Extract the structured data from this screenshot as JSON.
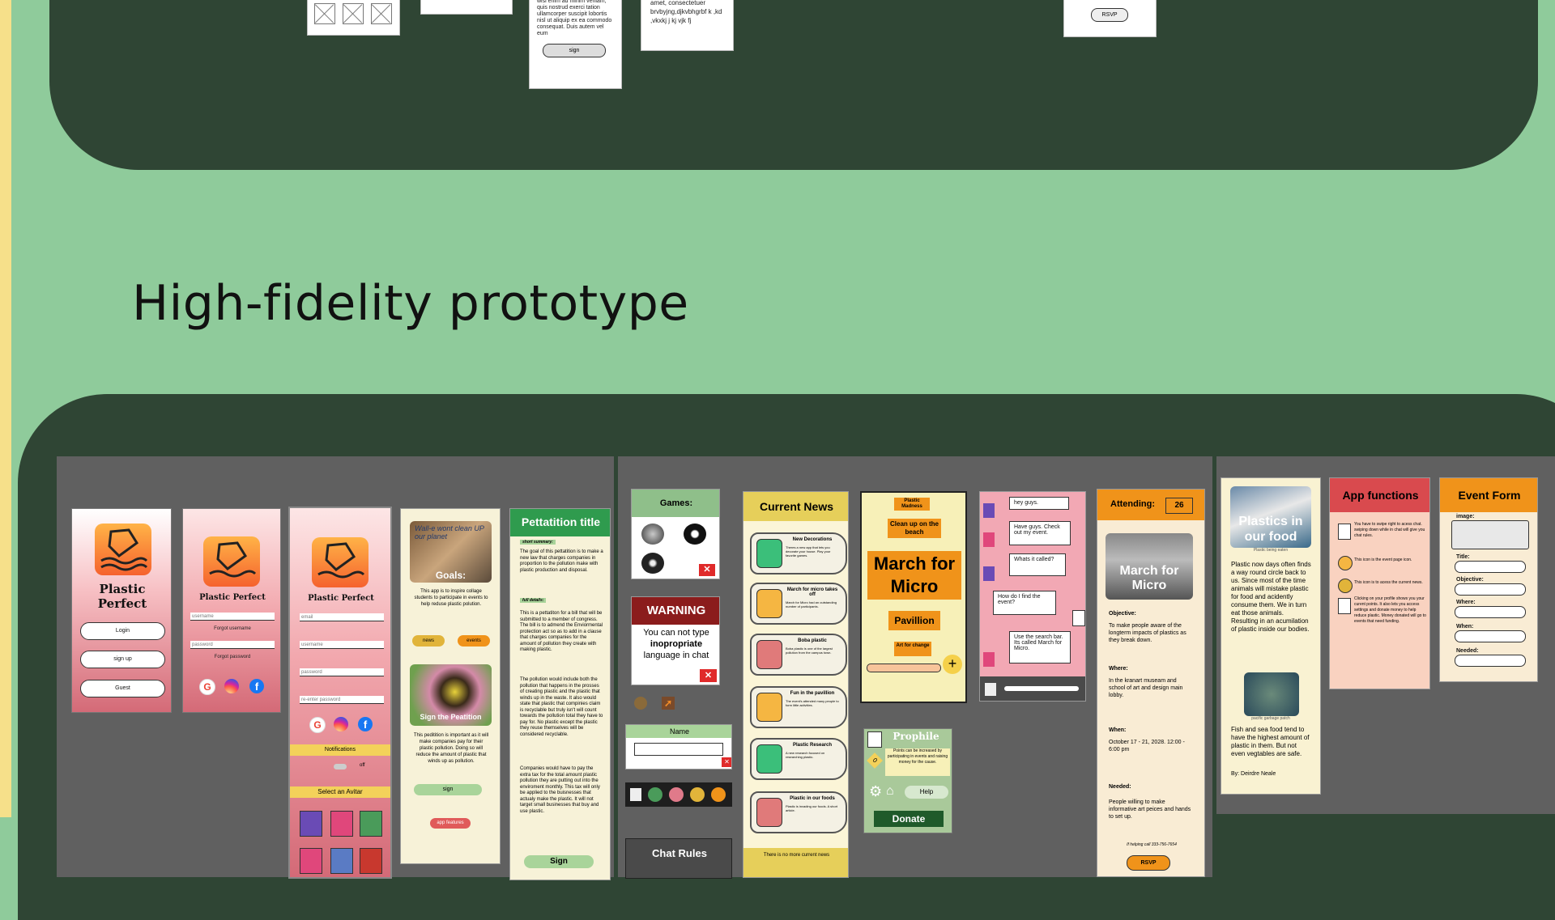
{
  "heading": "High-fidelity prototype",
  "wireframes": {
    "w3_text": "wisi enim ad minim veniam, quis nostrud exerci tation ullamcorper suscipit lobortis nisl ut aliquip ex ea commodo consequat. Duis autem vel eum",
    "w3_button": "sign",
    "w4_text": "amet, consectetuer brvbyjng,djkvbhgrbf k ,kd ,vkxkj j kj vjk fj",
    "w5_button": "RSVP"
  },
  "login": {
    "app_name": "Plastic Perfect",
    "buttons": [
      "Login",
      "sign up",
      "Guest"
    ]
  },
  "forgot": {
    "app_name": "Plastic Perfect",
    "username_placeholder": "username",
    "forgot_username": "Forgot username",
    "password_placeholder": "password",
    "forgot_password": "Forgot password"
  },
  "signup": {
    "app_name": "Plastic Perfect",
    "fields": [
      "email",
      "username",
      "password",
      "re-enter password"
    ],
    "notifications_label": "Notifications",
    "toggle_state": "off",
    "avatar_label": "Select an Avitar"
  },
  "goals": {
    "image_caption": "Goals:",
    "photo_sign_text": "Wall-e wont clean UP our planet",
    "text": "This app is to inspire collage students to participate in events to help reduse plastic polution.",
    "news_button": "news",
    "events_button": "events",
    "petition_caption": "Sign the Peatition",
    "petition_text": "This peditition is important as it will make companies pay for their plastic pollution. Doing so will reduce the amount of plastic that winds up as pollution.",
    "sign_button": "sign",
    "features_button": "app features"
  },
  "petition": {
    "title": "Pettatition title",
    "summary_label": "short summary:",
    "summary": "The goal of this pettatition is to make a new law that charges companies in proportion to the pollution make with plastic production and disposal.",
    "details_label": "full details:",
    "details": "This is a pettatiton for a bill that will be submitted to a member of congress. The bill is to admend the Enviormental protection act so as to add in a clause that charges companies for the amount of pollution they create with making plastic.",
    "details2": "The pollution would include both the pollution that happens in the prosses of creating plastic and the plastic that winds up in the waste. It also would state that plastic that compinies claim is recyclable but truly isn't will count towards the pollution total they have to pay for. No plastic except the plastic they reuse themselves will be considered recyclable.",
    "details3": "Companies would have to pay the extra tax for the total amount plastic pollution they are putting out into the enviroment monthly. This tax will only be applied to the buisnesses that actualy make the plastic. It will not target small businesses that buy and use plastic.",
    "sign_button": "Sign"
  },
  "games": {
    "title": "Games:",
    "warning_title": "WARNING",
    "warning_line1": "You can not type",
    "warning_line2": "inopropriate",
    "warning_line3": "language in chat",
    "name_label": "Name",
    "chat_rules": "Chat Rules"
  },
  "news": {
    "title": "Current News",
    "items": [
      {
        "title": "New Decorations",
        "text": "Theres a new app that lets you decorate your house. Play your favorite games."
      },
      {
        "title": "March for micro takes off",
        "text": "March for Micro had an outstanding number of participants."
      },
      {
        "title": "Boba plastic",
        "text": "Boba plastic is one of the largest pollution from the campus town."
      },
      {
        "title": "Fun in the pavillion",
        "text": "The event's attended many people to form little activities."
      },
      {
        "title": "Plastic Research",
        "text": "A new research focused on researching plastic."
      },
      {
        "title": "Plastic in our foods",
        "text": "Plastic is invading our foods. A short article."
      }
    ],
    "footer": "There is no more current news"
  },
  "events": {
    "tag1": "Plastic Madness",
    "tag2": "Clean up on the beach",
    "main": "March for Micro",
    "tag3": "Pavillion",
    "tag4": "Art for change",
    "plus": "+"
  },
  "chat": {
    "messages": [
      "hey guys.",
      "Have guys. Check out my event.",
      "Whats it called?",
      "How do I find the event?",
      "Use the search bar. Its called March for Micro."
    ]
  },
  "profile": {
    "title": "Prophile",
    "points": "0",
    "points_text": "Points can be increased by participating in events and raising money for the cause.",
    "help_button": "Help",
    "donate_button": "Donate"
  },
  "event_detail": {
    "attending_label": "Attending:",
    "attending_count": "26",
    "image_title": "March for Micro",
    "objective_label": "Objective:",
    "objective": "To make people aware of the longterm impacts of plastics as they break down.",
    "where_label": "Where:",
    "where": "In the kranart museam and school of art and design main lobby.",
    "when_label": "When:",
    "when": "October 17 - 21, 2028. 12:00 - 6:00 pm",
    "needed_label": "Needed:",
    "needed": "People willing to make informative art peices and hands to set up.",
    "contact": "If helping call 333-756-7654",
    "rsvp_button": "RSVP"
  },
  "article": {
    "image_title": "Plastics in our food",
    "image_caption": "Plastic being eaten",
    "text": "Plastic now days often finds a way round circle back to us. Since most of the time animals will mistake plastic for food and acidently consume them. We in turn eat those animals. Resulting in an acumilation of plastic inside our bodies.",
    "image2_caption": "pacific garbage patch",
    "text2": "Fish and sea food tend to have the highest amount of plastic in them. But not even vegtables are safe.",
    "author": "By: Deirdre Neale"
  },
  "functions": {
    "title": "App functions",
    "items": [
      "You have to swipe right to acess chat. swiping down while in chat will give you chat rules.",
      "This icon is the event page icon.",
      "This icon is to acess the current news.",
      "Clicking on your profile shows you your curent points. It also lets you access settings and donate money to help reduce plastic. Money donated will go to events that need funding."
    ]
  },
  "event_form": {
    "title": "Event Form",
    "labels": [
      "image:",
      "Title:",
      "Objective:",
      "Where:",
      "When:",
      "Needed:"
    ]
  },
  "colors": {
    "dark_board": "#2f4534",
    "background": "#8fcb9b",
    "panel": "#606060",
    "accent_orange": "#f0931a",
    "accent_red": "#d94a4e"
  }
}
